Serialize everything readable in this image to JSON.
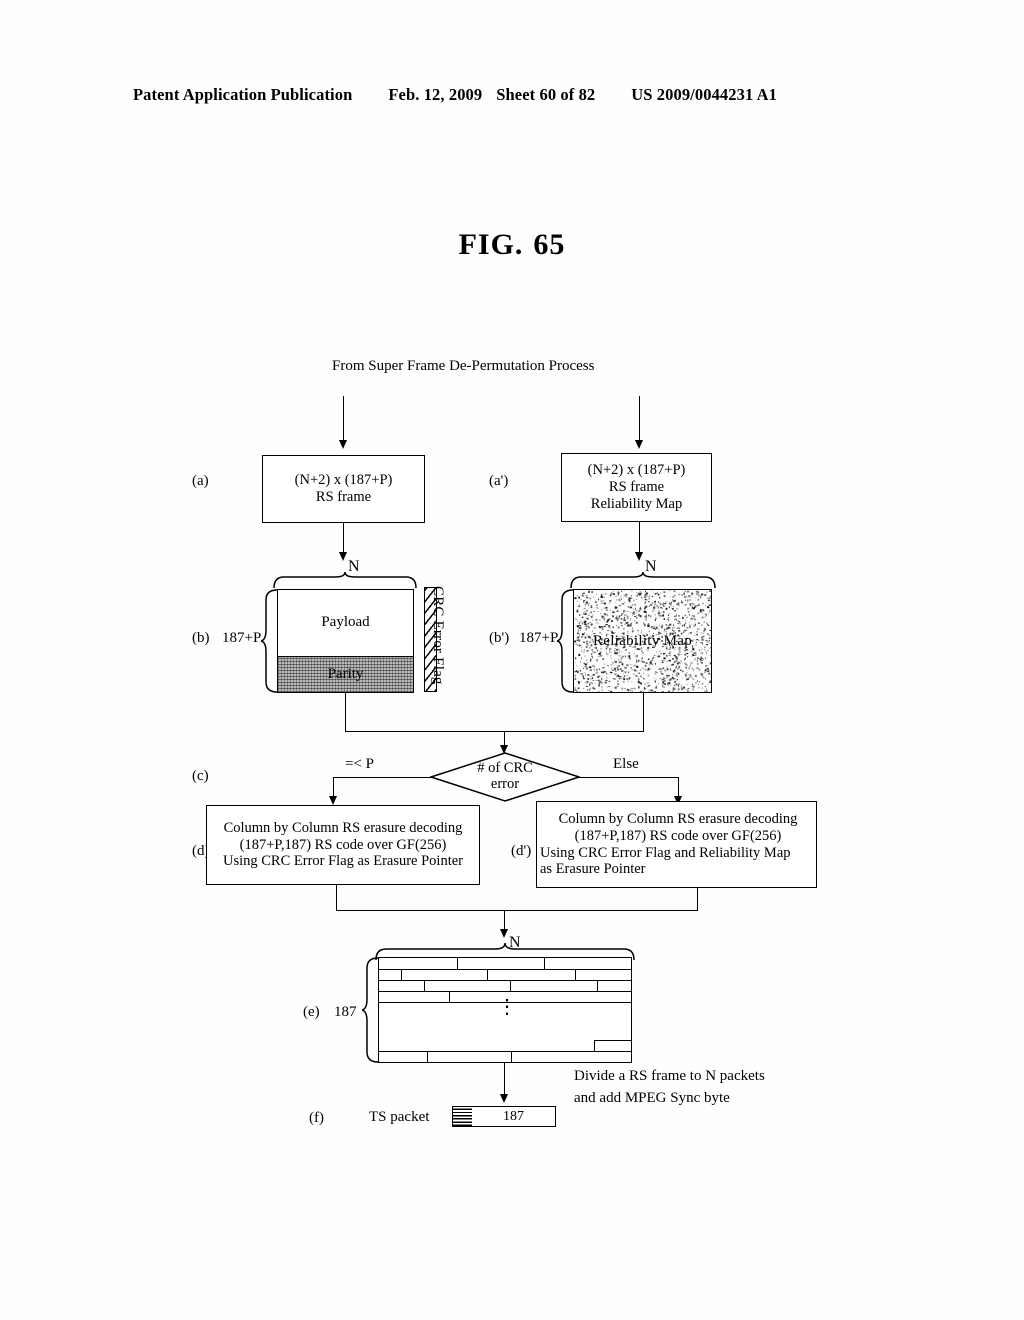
{
  "header": {
    "publication": "Patent Application Publication",
    "date": "Feb. 12, 2009",
    "sheet": "Sheet 60 of 82",
    "patent_number": "US 2009/0044231 A1"
  },
  "figure": {
    "label": "FIG.",
    "number": "65",
    "source_caption": "From Super Frame De-Permutation Process"
  },
  "steps": {
    "a": {
      "tag": "(a)",
      "box_line1": "(N+2) x (187+P)",
      "box_line2": "RS frame"
    },
    "a_prime": {
      "tag": "(a')",
      "box_line1": "(N+2) x (187+P)",
      "box_line2": "RS frame",
      "box_line3": "Reliability Map"
    },
    "b": {
      "tag": "(b)",
      "row_label": "187+P",
      "top_label": "N",
      "payload": "Payload",
      "parity": "Parity",
      "crc_flag": "CRC Error Flag"
    },
    "b_prime": {
      "tag": "(b')",
      "row_label": "187+P",
      "top_label": "N",
      "map": "Reliability Map"
    },
    "c": {
      "tag": "(c)",
      "decision_line1": "# of CRC",
      "decision_line2": "error",
      "branch_left": "=< P",
      "branch_right": "Else"
    },
    "d": {
      "tag": "(d)",
      "line1": "Column by Column RS erasure decoding",
      "line2": "(187+P,187) RS code over GF(256)",
      "line3": "Using CRC Error Flag as Erasure Pointer"
    },
    "d_prime": {
      "tag": "(d')",
      "line1": "Column by Column RS erasure decoding",
      "line2": "(187+P,187) RS code over GF(256)",
      "line3": "Using CRC Error Flag and Reliability Map",
      "line4": "as Erasure Pointer"
    },
    "e": {
      "tag": "(e)",
      "row_label": "187",
      "top_label": "N",
      "vertical_dots": "⋮"
    },
    "f": {
      "tag": "(f)",
      "name": "TS packet",
      "payload_size": "187",
      "note_line1": "Divide a RS frame to N packets",
      "note_line2": "and add MPEG Sync byte"
    }
  }
}
